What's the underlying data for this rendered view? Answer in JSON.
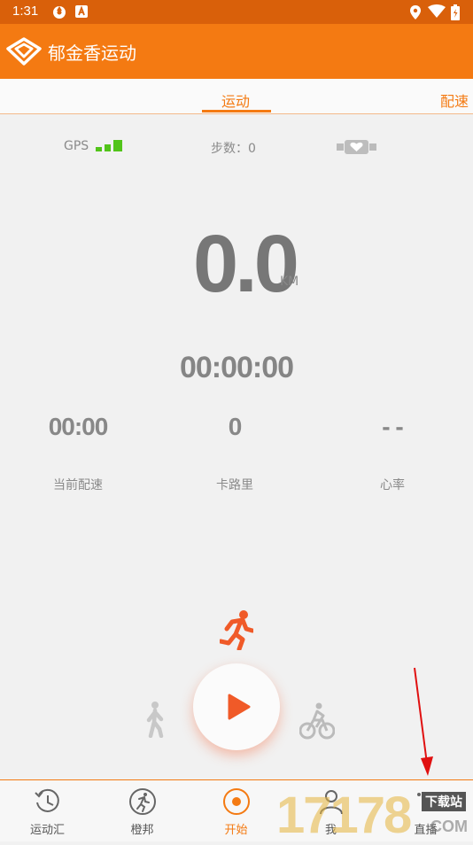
{
  "status_bar": {
    "time": "1:31"
  },
  "app_bar": {
    "title": "郁金香运动"
  },
  "tabs": [
    {
      "label": "运动",
      "active": true
    },
    {
      "label": "配速",
      "active": false
    }
  ],
  "top_metrics": {
    "gps_label": "GPS",
    "steps_text": "步数：0"
  },
  "distance": {
    "value": "0.0",
    "unit": "KM"
  },
  "duration": "00:00:00",
  "stats": [
    {
      "value": "00:00",
      "label": "当前配速"
    },
    {
      "value": "0",
      "label": "卡路里"
    },
    {
      "value": "- -",
      "label": "心率"
    }
  ],
  "modes": {
    "selected": "running-icon"
  },
  "bottom_nav": [
    {
      "label": "运动汇",
      "icon": "history-icon"
    },
    {
      "label": "橙邦",
      "icon": "runner-circle-icon"
    },
    {
      "label": "开始",
      "icon": "record-icon",
      "active": true
    },
    {
      "label": "我",
      "icon": "person-icon"
    },
    {
      "label": "直播",
      "icon": "live-icon"
    }
  ],
  "watermark": {
    "big": "17178",
    "small": "下载站",
    "small2": "COM"
  },
  "colors": {
    "accent": "#f47a12",
    "status_bar": "#d9600a",
    "play": "#f05a28"
  }
}
